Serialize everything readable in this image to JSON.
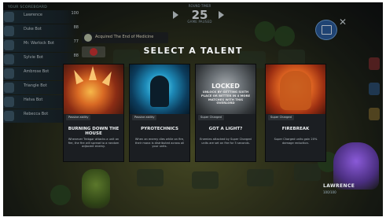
{
  "scoreboard": {
    "title": "YOUR SCOREBOARD",
    "players": [
      {
        "name": "Lawrence",
        "stat": "100"
      },
      {
        "name": "Duke Bot",
        "stat": "88"
      },
      {
        "name": "Mr. Warlock Bot",
        "stat": "77"
      },
      {
        "name": "Sylvie Bot",
        "stat": "88"
      },
      {
        "name": "Ambrose Bot",
        "stat": ""
      },
      {
        "name": "Triangle Bot",
        "stat": ""
      },
      {
        "name": "Helva Bot",
        "stat": ""
      },
      {
        "name": "Rebecca Bot",
        "stat": ""
      }
    ]
  },
  "timer": {
    "top_label": "ROUND TIMER",
    "value": "25",
    "bottom_label": "GAME PAUSED"
  },
  "toast": {
    "text": "Acquired The End of Medicine"
  },
  "modal": {
    "title": "SELECT A TALENT",
    "cards": [
      {
        "tag": "Passive ability",
        "name": "BURNING DOWN THE HOUSE",
        "desc": "Whenever Trebgar attacks a unit on fire, the fire will spread to a random adjacent enemy.",
        "locked": false
      },
      {
        "tag": "Passive ability",
        "name": "PYROTECHNICS",
        "desc": "When an enemy dies while on fire, their mana is distributed across all your units.",
        "locked": false
      },
      {
        "tag": "Super Charged",
        "name": "GOT A LIGHT?",
        "desc": "Enemies attacked by Super Charged units are set on fire for 5 seconds.",
        "locked": true,
        "lock_title": "LOCKED",
        "lock_text": "UNLOCK BY GETTING SIXTH PLACE OR BETTER IN 4 MORE MATCHES WITH THIS OVERLORD"
      },
      {
        "tag": "Super Charged",
        "name": "FIREBREAK",
        "desc": "Super Charged units gain 20% damage reduction.",
        "locked": false
      }
    ]
  },
  "player": {
    "name": "LAWRENCE",
    "hp": "100/100"
  },
  "colors": {
    "card_bg": "#1b1e22",
    "title": "#f2f4f6",
    "store_button": "#2a5a9a"
  }
}
